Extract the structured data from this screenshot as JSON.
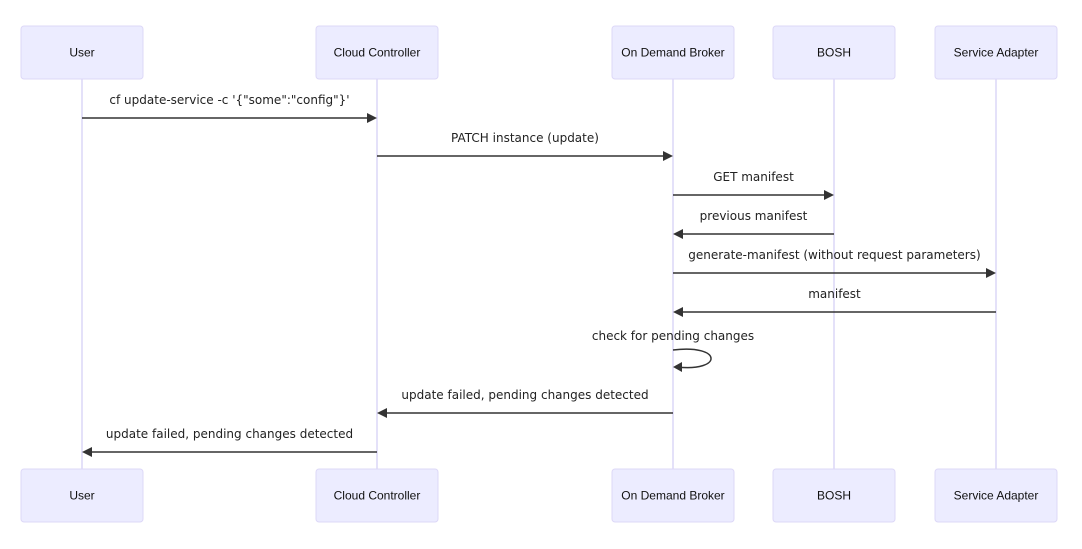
{
  "diagram": {
    "type": "sequence",
    "participants": [
      {
        "id": "user",
        "label": "User"
      },
      {
        "id": "cc",
        "label": "Cloud Controller"
      },
      {
        "id": "odb",
        "label": "On Demand Broker"
      },
      {
        "id": "bosh",
        "label": "BOSH"
      },
      {
        "id": "sa",
        "label": "Service Adapter"
      }
    ],
    "messages": [
      {
        "from": "user",
        "to": "cc",
        "label": "cf update-service -c '{\"some\":\"config\"}'"
      },
      {
        "from": "cc",
        "to": "odb",
        "label": "PATCH instance (update)"
      },
      {
        "from": "odb",
        "to": "bosh",
        "label": "GET manifest"
      },
      {
        "from": "bosh",
        "to": "odb",
        "label": "previous manifest"
      },
      {
        "from": "odb",
        "to": "sa",
        "label": "generate-manifest (without request parameters)"
      },
      {
        "from": "sa",
        "to": "odb",
        "label": "manifest"
      },
      {
        "from": "odb",
        "to": "odb",
        "label": "check for pending changes"
      },
      {
        "from": "odb",
        "to": "cc",
        "label": "update failed, pending changes detected"
      },
      {
        "from": "cc",
        "to": "user",
        "label": "update failed, pending changes detected"
      }
    ]
  },
  "colors": {
    "actor_fill": "#ececff",
    "actor_border": "#ddd8f7",
    "lifeline": "#d3cdf5",
    "message_line": "#333333"
  }
}
